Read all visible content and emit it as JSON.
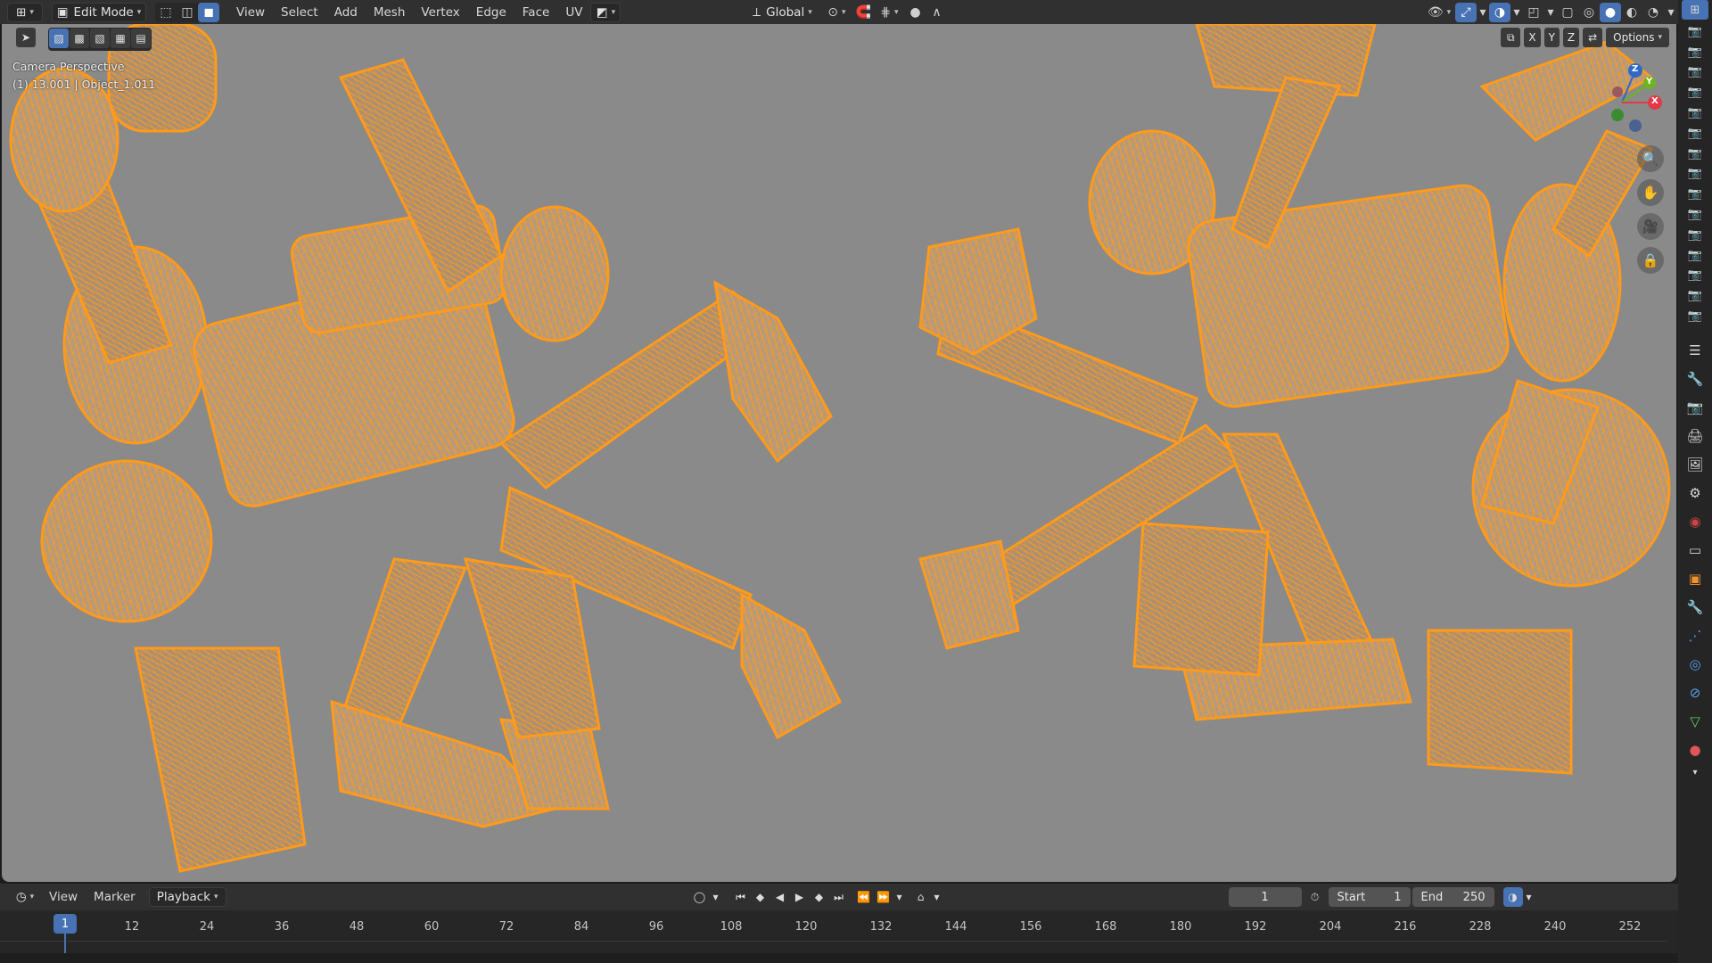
{
  "header": {
    "editor_icon": "3d-viewport-icon",
    "mode": "Edit Mode",
    "menus": [
      "View",
      "Select",
      "Add",
      "Mesh",
      "Vertex",
      "Edge",
      "Face",
      "UV"
    ],
    "transform_orientation": "Global",
    "options_label": "Options",
    "axis_labels": [
      "X",
      "Y",
      "Z"
    ]
  },
  "viewport": {
    "camera_label": "Camera Perspective",
    "object_label": "(1) 13.001 | Object_1.011",
    "background_color": "#8a8a8a",
    "wire_color": "#ff9a1a",
    "gizmo_axes": [
      "Z",
      "Y",
      "X"
    ]
  },
  "timeline": {
    "menus": [
      "View",
      "Marker",
      "Playback"
    ],
    "current_frame": "1",
    "start_label": "Start",
    "start_value": "1",
    "end_label": "End",
    "end_value": "250",
    "playhead_label": "1",
    "ticks": [
      "12",
      "24",
      "36",
      "48",
      "60",
      "72",
      "84",
      "96",
      "108",
      "120",
      "132",
      "144",
      "156",
      "168",
      "180",
      "192",
      "204",
      "216",
      "228",
      "240",
      "252"
    ]
  },
  "colors": {
    "accent": "#4772b3",
    "header_bg": "#303030",
    "wire": "#ff9a1a"
  }
}
